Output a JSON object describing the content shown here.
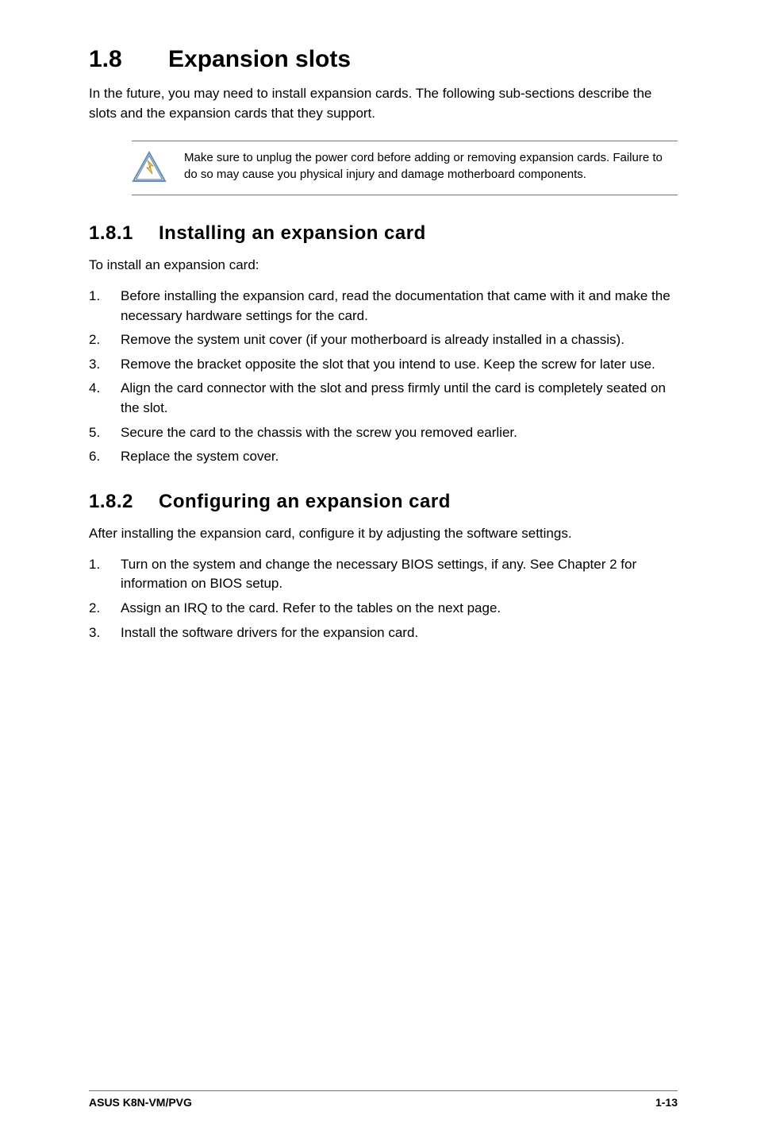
{
  "main": {
    "number": "1.8",
    "title": "Expansion slots",
    "intro": "In the future, you may need to install expansion cards. The following sub-sections describe the slots and the expansion cards that they support."
  },
  "warning": {
    "text": "Make sure to unplug the power cord before adding or removing expansion cards. Failure to do so may cause you physical injury and damage motherboard components."
  },
  "sec1": {
    "number": "1.8.1",
    "title": "Installing an expansion card",
    "lead": "To install an expansion card:",
    "steps": [
      "Before installing the expansion card, read the documentation that came with it and make the necessary hardware settings for the card.",
      "Remove the system unit cover (if your motherboard is already installed in a chassis).",
      "Remove the bracket opposite the slot that you intend to use. Keep the screw for later use.",
      "Align the card connector with the slot and press firmly until the card is completely seated on the slot.",
      "Secure the card to the chassis with the screw you removed earlier.",
      "Replace the system cover."
    ]
  },
  "sec2": {
    "number": "1.8.2",
    "title": "Configuring an expansion card",
    "lead": "After installing the expansion card, configure it by adjusting the software settings.",
    "steps": [
      "Turn on the system and change the necessary BIOS settings, if any. See Chapter 2 for information on BIOS setup.",
      "Assign an IRQ to the card. Refer to the tables on the next page.",
      "Install the software drivers for the expansion card."
    ]
  },
  "footer": {
    "left": "ASUS K8N-VM/PVG",
    "right": "1-13"
  }
}
